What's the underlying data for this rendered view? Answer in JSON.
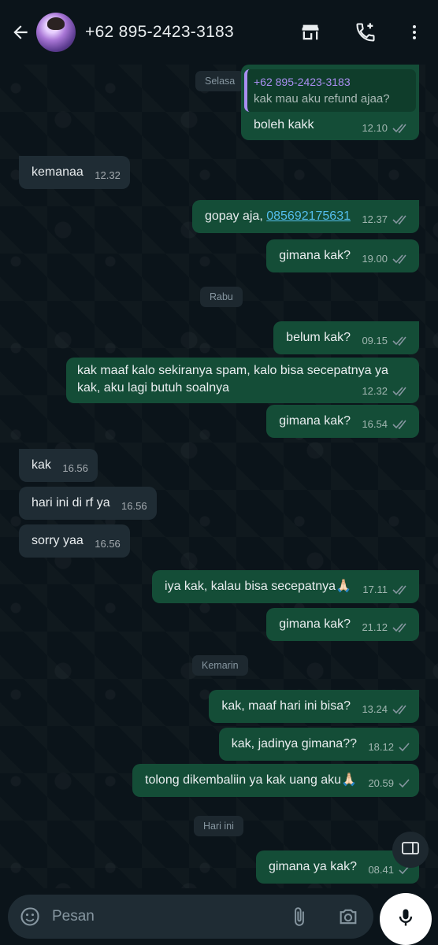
{
  "header": {
    "contact_name": "+62 895-2423-3183",
    "icons": [
      "back-arrow-icon",
      "store-icon",
      "add-call-icon",
      "more-vert-icon"
    ]
  },
  "dates": {
    "selasa": "Selasa",
    "rabu": "Rabu",
    "kemarin": "Kemarin",
    "hari_ini": "Hari ini"
  },
  "messages": [
    {
      "dir": "out",
      "reply_to_name": "+62 895-2423-3183",
      "reply_to_text": "kak mau aku refund ajaa?",
      "text": "boleh kakk",
      "time": "12.10",
      "status": "read"
    },
    {
      "dir": "in",
      "text": "kemanaa",
      "time": "12.32"
    },
    {
      "dir": "out",
      "text_prefix": "gopay aja, ",
      "link": "085692175631",
      "time": "12.37",
      "status": "read"
    },
    {
      "dir": "out",
      "text": "gimana kak?",
      "time": "19.00",
      "status": "read"
    },
    {
      "dir": "out",
      "text": "belum kak?",
      "time": "09.15",
      "status": "read"
    },
    {
      "dir": "out",
      "text": "kak maaf kalo sekiranya spam, kalo bisa secepatnya ya kak, aku lagi butuh soalnya",
      "time": "12.32",
      "status": "read"
    },
    {
      "dir": "out",
      "text": "gimana kak?",
      "time": "16.54",
      "status": "read"
    },
    {
      "dir": "in",
      "text": "kak",
      "time": "16.56"
    },
    {
      "dir": "in",
      "text": "hari ini di rf ya",
      "time": "16.56"
    },
    {
      "dir": "in",
      "text": "sorry yaa",
      "time": "16.56"
    },
    {
      "dir": "out",
      "text": "iya kak, kalau bisa secepatnya🙏🏻",
      "time": "17.11",
      "status": "read"
    },
    {
      "dir": "out",
      "text": "gimana kak?",
      "time": "21.12",
      "status": "read"
    },
    {
      "dir": "out",
      "text": "kak, maaf hari ini bisa?",
      "time": "13.24",
      "status": "read"
    },
    {
      "dir": "out",
      "text": "kak, jadinya gimana??",
      "time": "18.12",
      "status": "delivered"
    },
    {
      "dir": "out",
      "text": "tolong dikembaliin ya kak uang aku🙏🏻",
      "time": "20.59",
      "status": "delivered"
    },
    {
      "dir": "out",
      "text": "gimana ya kak?",
      "time": "08.41",
      "status": "delivered"
    }
  ],
  "composer": {
    "placeholder": "Pesan",
    "icons": [
      "emoji-sticker-icon",
      "attach-icon",
      "camera-icon",
      "mic-icon"
    ]
  },
  "colors": {
    "background": "#0b141a",
    "outgoing_bubble": "#144d37",
    "incoming_bubble": "#1f2c34",
    "link": "#53bdeb",
    "read_ticks": "#8696a0"
  }
}
